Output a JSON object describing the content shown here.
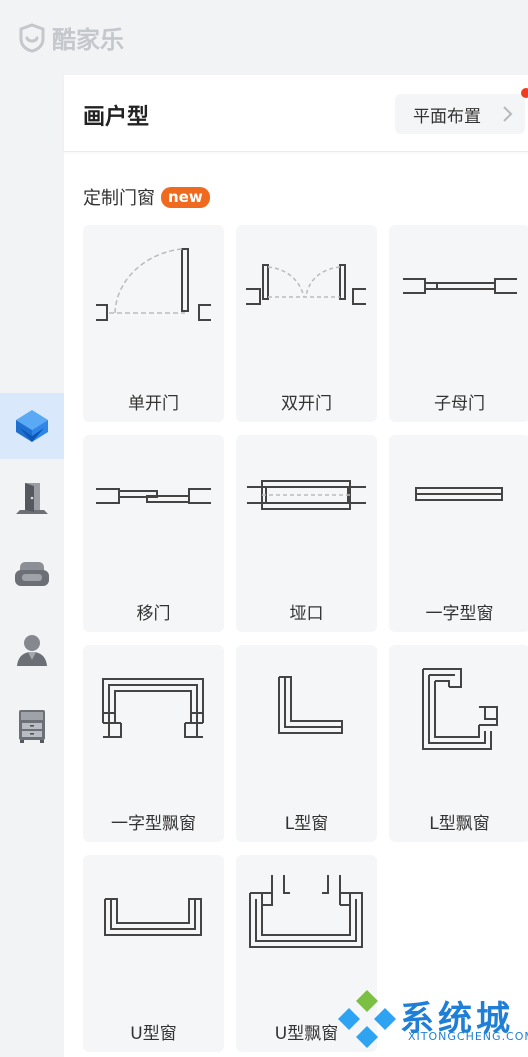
{
  "app": {
    "logo_text": "酷家乐"
  },
  "panel": {
    "title": "画户型",
    "layout_button": "平面布置",
    "section_title": "定制门窗",
    "new_badge": "new"
  },
  "rail": {
    "items": [
      {
        "icon": "hard-decor-cube-icon",
        "active": true
      },
      {
        "icon": "door-icon",
        "active": false
      },
      {
        "icon": "sofa-icon",
        "active": false
      },
      {
        "icon": "person-icon",
        "active": false
      },
      {
        "icon": "cabinet-icon",
        "active": false
      }
    ]
  },
  "items": [
    {
      "label": "单开门",
      "icon": "single-door-icon"
    },
    {
      "label": "双开门",
      "icon": "double-door-icon"
    },
    {
      "label": "子母门",
      "icon": "mother-child-door-icon"
    },
    {
      "label": "移门",
      "icon": "sliding-door-icon"
    },
    {
      "label": "垭口",
      "icon": "doorway-opening-icon"
    },
    {
      "label": "一字型窗",
      "icon": "straight-window-icon"
    },
    {
      "label": "一字型飘窗",
      "icon": "straight-bay-window-icon"
    },
    {
      "label": "L型窗",
      "icon": "l-window-icon"
    },
    {
      "label": "L型飘窗",
      "icon": "l-bay-window-icon"
    },
    {
      "label": "U型窗",
      "icon": "u-window-icon"
    },
    {
      "label": "U型飘窗",
      "icon": "u-bay-window-icon"
    }
  ],
  "watermark": {
    "text": "系统城",
    "sub": "XITONGCHENG.COM"
  },
  "colors": {
    "accent": "#1f7fd6",
    "badge": "#ef6a1f",
    "active_rail": "#d9e9fb"
  }
}
